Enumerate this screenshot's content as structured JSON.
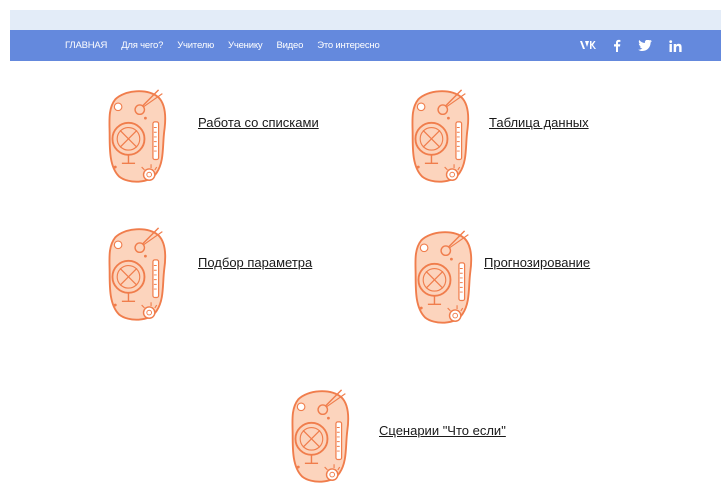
{
  "nav": {
    "items": [
      {
        "label": "ГЛАВНАЯ"
      },
      {
        "label": "Для чего?"
      },
      {
        "label": "Учителю"
      },
      {
        "label": "Ученику"
      },
      {
        "label": "Видео"
      },
      {
        "label": "Это интересно"
      }
    ],
    "social": [
      {
        "icon": "vk-icon",
        "glyph": "ᴡᴋ"
      },
      {
        "icon": "facebook-icon",
        "glyph": "f"
      },
      {
        "icon": "twitter-icon",
        "glyph": ""
      },
      {
        "icon": "linkedin-icon",
        "glyph": "in"
      }
    ]
  },
  "colors": {
    "nav_bg": "#6489dd",
    "top_strip": "#e3ecf8",
    "icon_fill": "#fcd4bd",
    "icon_stroke": "#f07d4c"
  },
  "topics": [
    {
      "label": "Работа со списками",
      "icon": "science-lab-icon"
    },
    {
      "label": "Таблица данных",
      "icon": "science-lab-icon"
    },
    {
      "label": "Подбор параметра",
      "icon": "science-lab-icon"
    },
    {
      "label": "Прогнозирование",
      "icon": "science-lab-icon"
    },
    {
      "label": "Сценарии \"Что если\"",
      "icon": "science-lab-icon"
    }
  ]
}
